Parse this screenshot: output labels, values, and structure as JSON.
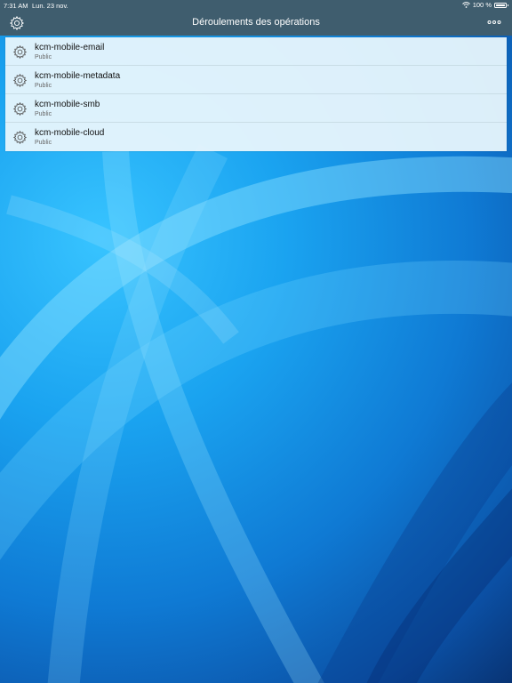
{
  "status": {
    "time": "7:31 AM",
    "date": "Lun. 23 nov.",
    "battery": "100 %"
  },
  "navbar": {
    "title": "Déroulements des opérations",
    "settings_icon": "gear-icon",
    "more_icon": "more-dots-icon"
  },
  "workflows": [
    {
      "name": "kcm-mobile-email",
      "visibility": "Public",
      "icon": "gear-icon"
    },
    {
      "name": "kcm-mobile-metadata",
      "visibility": "Public",
      "icon": "gear-icon"
    },
    {
      "name": "kcm-mobile-smb",
      "visibility": "Public",
      "icon": "gear-icon"
    },
    {
      "name": "kcm-mobile-cloud",
      "visibility": "Public",
      "icon": "gear-icon"
    }
  ],
  "colors": {
    "navbar": "#3f5d6e",
    "list_background": "#e8f6fc",
    "wallpaper_light": "#38c4ff",
    "wallpaper_dark": "#08306e"
  }
}
